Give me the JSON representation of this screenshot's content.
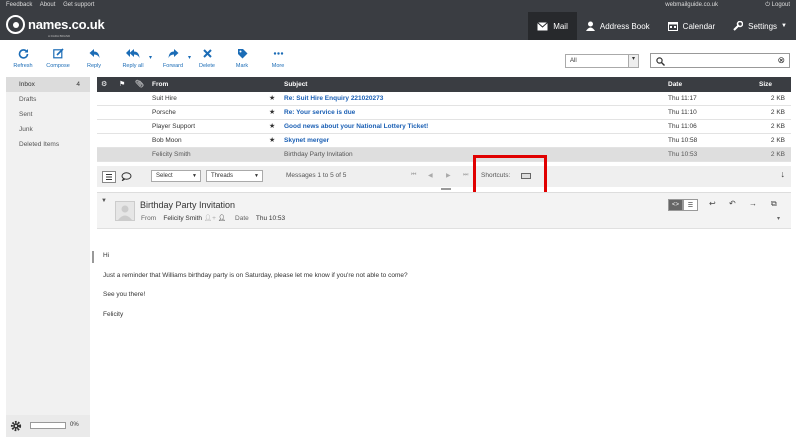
{
  "topbar": {
    "links": [
      "Feedback",
      "About",
      "Get support"
    ],
    "logo_text": "names.co.uk",
    "logo_sub": "A DADA BRAND",
    "account": "webmailguide.co.uk",
    "logout": "Logout",
    "nav": [
      {
        "label": "Mail",
        "icon": "envelope-icon",
        "active": true
      },
      {
        "label": "Address Book",
        "icon": "person-icon",
        "active": false
      },
      {
        "label": "Calendar",
        "icon": "calendar-icon",
        "active": false
      },
      {
        "label": "Settings",
        "icon": "wrench-icon",
        "active": false
      }
    ]
  },
  "toolbar": {
    "refresh": "Refresh",
    "compose": "Compose",
    "reply": "Reply",
    "reply_all": "Reply all",
    "forward": "Forward",
    "delete": "Delete",
    "mark": "Mark",
    "more": "More",
    "filter_value": "All",
    "search_value": ""
  },
  "sidebar": {
    "folders": [
      {
        "name": "Inbox",
        "count": "4",
        "active": true
      },
      {
        "name": "Drafts",
        "count": "",
        "active": false
      },
      {
        "name": "Sent",
        "count": "",
        "active": false
      },
      {
        "name": "Junk",
        "count": "",
        "active": false
      },
      {
        "name": "Deleted Items",
        "count": "",
        "active": false
      }
    ],
    "quota_percent": 0,
    "quota_text": "0%"
  },
  "list": {
    "columns": {
      "from": "From",
      "subject": "Subject",
      "date": "Date",
      "size": "Size"
    },
    "rows": [
      {
        "from": "Suit Hire",
        "subject": "Re: Suit Hire Enquiry 221020273",
        "date": "Thu 11:17",
        "size": "2 KB",
        "flagged": true
      },
      {
        "from": "Porsche",
        "subject": "Re: Your service is due",
        "date": "Thu 11:10",
        "size": "2 KB",
        "flagged": true
      },
      {
        "from": "Player Support",
        "subject": "Good news about your National Lottery Ticket!",
        "date": "Thu 11:06",
        "size": "2 KB",
        "flagged": true
      },
      {
        "from": "Bob Moon",
        "subject": "Skynet merger",
        "date": "Thu 10:58",
        "size": "2 KB",
        "flagged": true
      },
      {
        "from": "Felicity Smith",
        "subject": "Birthday Party Invitation",
        "date": "Thu 10:53",
        "size": "2 KB",
        "flagged": false
      }
    ],
    "footer": {
      "select": "Select",
      "threads": "Threads",
      "count_text": "Messages 1 to 5 of 5",
      "shortcuts": "Shortcuts:"
    }
  },
  "preview": {
    "subject": "Birthday Party Invitation",
    "from_label": "From",
    "from_value": "Felicity Smith",
    "date_label": "Date",
    "date_value": "Thu 10:53",
    "body": [
      "Hi",
      "Just a reminder that Williams birthday party is on Saturday, please let me know if you're not able to come?",
      "See you there!",
      "Felicity"
    ]
  },
  "colors": {
    "topbar": "#3a3d42",
    "accent": "#1b6cb6",
    "highlight": "#e00000"
  }
}
